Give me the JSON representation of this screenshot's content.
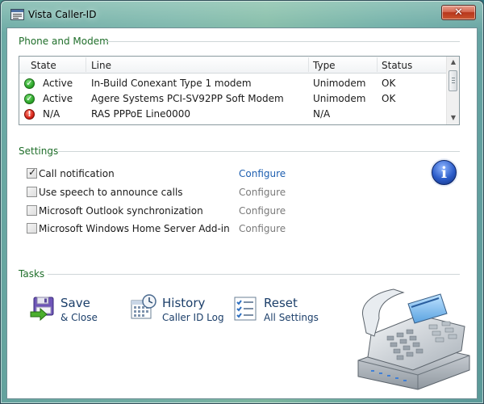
{
  "window": {
    "title": "Vista Caller-ID",
    "close_glyph": "✕"
  },
  "phone_modem": {
    "group_title": "Phone and Modem",
    "columns": [
      "State",
      "Line",
      "Type",
      "Status"
    ],
    "rows": [
      {
        "state": "Active",
        "state_icon": "check-circle-icon",
        "line": "In-Build Conexant Type 1 modem",
        "type": "Unimodem",
        "status": "OK"
      },
      {
        "state": "Active",
        "state_icon": "check-circle-icon",
        "line": "Agere Systems PCI-SV92PP Soft Modem",
        "type": "Unimodem",
        "status": "OK"
      },
      {
        "state": "N/A",
        "state_icon": "error-circle-icon",
        "line": "RAS PPPoE Line0000",
        "type": "N/A",
        "status": ""
      }
    ]
  },
  "settings": {
    "group_title": "Settings",
    "items": [
      {
        "label": "Call notification",
        "checked": true,
        "configure": "Configure",
        "configure_enabled": true
      },
      {
        "label": "Use speech to announce calls",
        "checked": false,
        "configure": "Configure",
        "configure_enabled": false
      },
      {
        "label": "Microsoft Outlook synchronization",
        "checked": false,
        "configure": "Configure",
        "configure_enabled": false
      },
      {
        "label": "Microsoft Windows Home Server Add-in",
        "checked": false,
        "configure": "Configure",
        "configure_enabled": false
      }
    ],
    "info_glyph": "i"
  },
  "tasks": {
    "group_title": "Tasks",
    "items": [
      {
        "title": "Save",
        "subtitle": "& Close",
        "icon": "save-disk-icon"
      },
      {
        "title": "History",
        "subtitle": "Caller ID Log",
        "icon": "calendar-history-icon"
      },
      {
        "title": "Reset",
        "subtitle": "All Settings",
        "icon": "checklist-icon"
      }
    ]
  },
  "colors": {
    "group_title": "#1f6e2a",
    "link": "#1e5fb0",
    "disabled_link": "#7a7a7a",
    "task_text": "#1c3f6a"
  }
}
